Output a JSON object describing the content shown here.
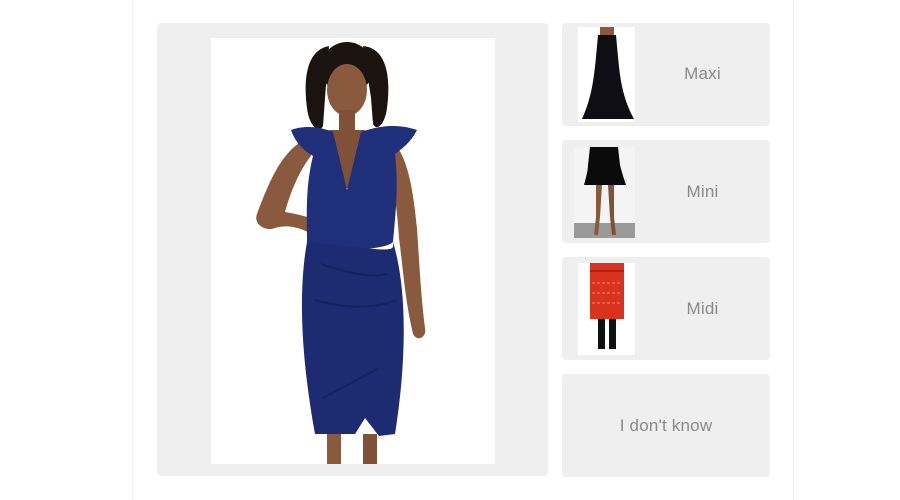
{
  "question": {
    "image_description": "model wearing navy ruffle-shoulder sheath midi dress"
  },
  "options": [
    {
      "label": "Maxi",
      "thumb_icon": "maxi-dress-thumbnail"
    },
    {
      "label": "Mini",
      "thumb_icon": "mini-dress-thumbnail"
    },
    {
      "label": "Midi",
      "thumb_icon": "midi-dress-thumbnail"
    },
    {
      "label": "I don't know"
    }
  ],
  "colors": {
    "card_background": "#efefef",
    "label_text": "#8a8a8a",
    "dress_navy": "#1f2f7a"
  }
}
